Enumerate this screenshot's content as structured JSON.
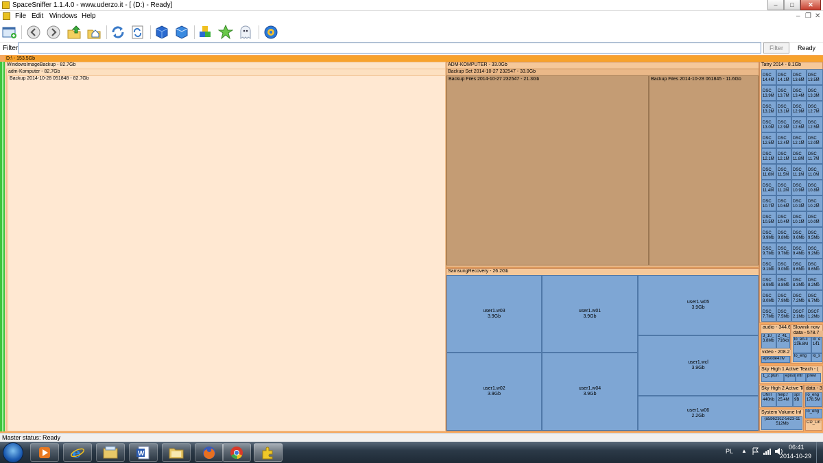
{
  "window": {
    "title": "SpaceSniffer 1.1.4.0 - www.uderzo.it - [ (D:) - Ready]",
    "min": "–",
    "max": "□",
    "close": "✕",
    "mdi_min": "–",
    "mdi_restore": "❐",
    "mdi_close": "✕"
  },
  "menu": [
    "File",
    "Edit",
    "Windows",
    "Help"
  ],
  "toolbar": {
    "icons": [
      "new-scan-icon",
      "back-icon",
      "forward-icon",
      "parent-folder-icon",
      "home-icon",
      "refresh-icon",
      "refresh-all-icon",
      "blue-box-icon",
      "blue-box-open-icon",
      "shapes-icon",
      "star-icon",
      "ghost-icon",
      "settings-gear-icon"
    ]
  },
  "filter": {
    "label": "Filter",
    "value": "",
    "button": "Filter",
    "status": "Ready"
  },
  "treemap": {
    "root": "D:\\ - 153.5Gb",
    "left": {
      "wib": "WindowsImageBackup - 82.7Gb",
      "adm": "adm-Komputer - 82.7Gb",
      "backup": "Backup 2014-10-28 051848 - 82.7Gb"
    },
    "mid": {
      "admk": "ADM-KOMPUTER - 33.0Gb",
      "set": "Backup Set 2014-10-27 232547 - 33.0Gb",
      "files1": "Backup Files 2014-10-27 232547 - 21.3Gb",
      "files2": "Backup Files 2014-10-28 061845 - 11.6Gb",
      "samsung": "SamsungRecovery - 26.2Gb",
      "files": [
        {
          "name": "user1.w03",
          "size": "3.9Gb"
        },
        {
          "name": "user1.w01",
          "size": "3.9Gb"
        },
        {
          "name": "user1.w05",
          "size": "3.9Gb"
        },
        {
          "name": "user1.w02",
          "size": "3.9Gb"
        },
        {
          "name": "user1.w04",
          "size": "3.9Gb"
        },
        {
          "name": "user1.wcl",
          "size": "3.9Gb"
        },
        {
          "name": "user1.w06",
          "size": "2.2Gb"
        }
      ]
    },
    "right": {
      "tatry": "Tatry 2014 - 8.1Gb",
      "photo_prefix": "DSC_",
      "photo_sizes": [
        "14.4M",
        "14.1M",
        "13.6M",
        "13.5M",
        "13.9M",
        "13.7M",
        "13.4M",
        "13.3M",
        "13.2M",
        "13.1M",
        "12.9M",
        "12.7M",
        "13.0M",
        "12.9M",
        "12.6M",
        "12.5M",
        "12.5M",
        "12.4M",
        "12.1M",
        "12.0M",
        "12.1M",
        "12.1M",
        "11.8M",
        "11.7M",
        "11.6M",
        "11.5M",
        "11.1M",
        "11.0M",
        "11.4M",
        "11.2M",
        "10.9M",
        "10.8M",
        "10.7M",
        "10.6M",
        "10.3M",
        "10.2M",
        "10.5M",
        "10.4M",
        "10.1M",
        "10.0M",
        "9.9Mb",
        "9.8Mb",
        "9.6Mb",
        "9.5Mb",
        "9.7Mb",
        "9.7Mb",
        "9.4Mb",
        "9.2Mb",
        "9.1Mb",
        "9.0Mb",
        "8.6Mb",
        "8.6Mb",
        "8.9Mb",
        "8.8Mb",
        "8.3Mb",
        "8.2Mb",
        "8.0Mb",
        "7.9Mb",
        "7.2Mb",
        "6.7Mb",
        "7.7Mb",
        "7.5Mb",
        "2.1Mb",
        "1.2Mb"
      ],
      "photo_last_names": [
        "DSC_",
        "DSC_",
        "DSCF",
        "DSCF"
      ],
      "audio": "audio - 344.6",
      "audio_files": [
        "3_10_ 3.8Mb",
        "2_41_ 716kb"
      ],
      "video": "video - 208.2",
      "video_file": "episode4.flv",
      "slownik": "Slownik now",
      "data1": "data - 578.7",
      "lo_en": "lo_en-c 236.8M",
      "lo_e2": "lo_e 141",
      "lo_eng": "lo_eng",
      "lo_s": "lo_s",
      "sky1": "Sky High 1 Active Teach - (",
      "sky1_files": [
        "1_2.plun",
        "episo",
        "intr",
        "previ"
      ],
      "sky2": "Sky High 2 Active Teac",
      "data3": "data - 3",
      "sky2_files": [
        "UNIT 440Kb",
        "help.f 25.4M",
        "spl 9B",
        "lo_eng 178.5M"
      ],
      "lo_eng2": "lo_eng",
      "svi": "System Volume Inf",
      "svi_file": "{a5b623c2-5e23-11 512Mb",
      "cd": "CD_Lin"
    }
  },
  "status": "Master status: Ready",
  "taskbar": {
    "apps": [
      "start-orb-icon",
      "media-player-icon",
      "internet-explorer-icon",
      "file-explorer-icon",
      "word-icon",
      "folder-icon",
      "firefox-icon",
      "chrome-icon",
      "spacesniffer-icon"
    ],
    "lang": "PL",
    "time": "06:41",
    "date": "2014-10-29"
  }
}
